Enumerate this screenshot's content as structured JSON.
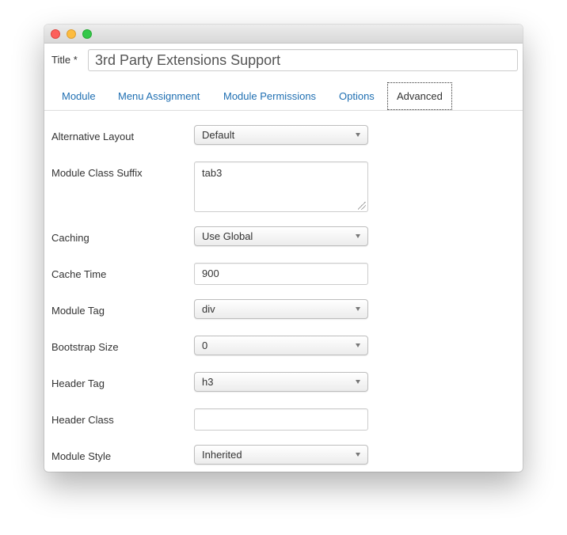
{
  "window": {
    "traffic_lights": [
      "close",
      "minimize",
      "zoom"
    ]
  },
  "title_field": {
    "label": "Title *",
    "value": "3rd Party Extensions Support"
  },
  "tabs": [
    {
      "label": "Module"
    },
    {
      "label": "Menu Assignment"
    },
    {
      "label": "Module Permissions"
    },
    {
      "label": "Options"
    },
    {
      "label": "Advanced",
      "active": true
    }
  ],
  "fields": {
    "alternative_layout": {
      "label": "Alternative Layout",
      "value": "Default"
    },
    "module_class_suffix": {
      "label": "Module Class Suffix",
      "value": "tab3"
    },
    "caching": {
      "label": "Caching",
      "value": "Use Global"
    },
    "cache_time": {
      "label": "Cache Time",
      "value": "900"
    },
    "module_tag": {
      "label": "Module Tag",
      "value": "div"
    },
    "bootstrap_size": {
      "label": "Bootstrap Size",
      "value": "0"
    },
    "header_tag": {
      "label": "Header Tag",
      "value": "h3"
    },
    "header_class": {
      "label": "Header Class",
      "value": ""
    },
    "module_style": {
      "label": "Module Style",
      "value": "Inherited"
    }
  },
  "colors": {
    "tab_link": "#1f6fb2",
    "text": "#333333",
    "close": "#fc605c",
    "minimize": "#fdbc40",
    "zoom": "#34c84a"
  }
}
